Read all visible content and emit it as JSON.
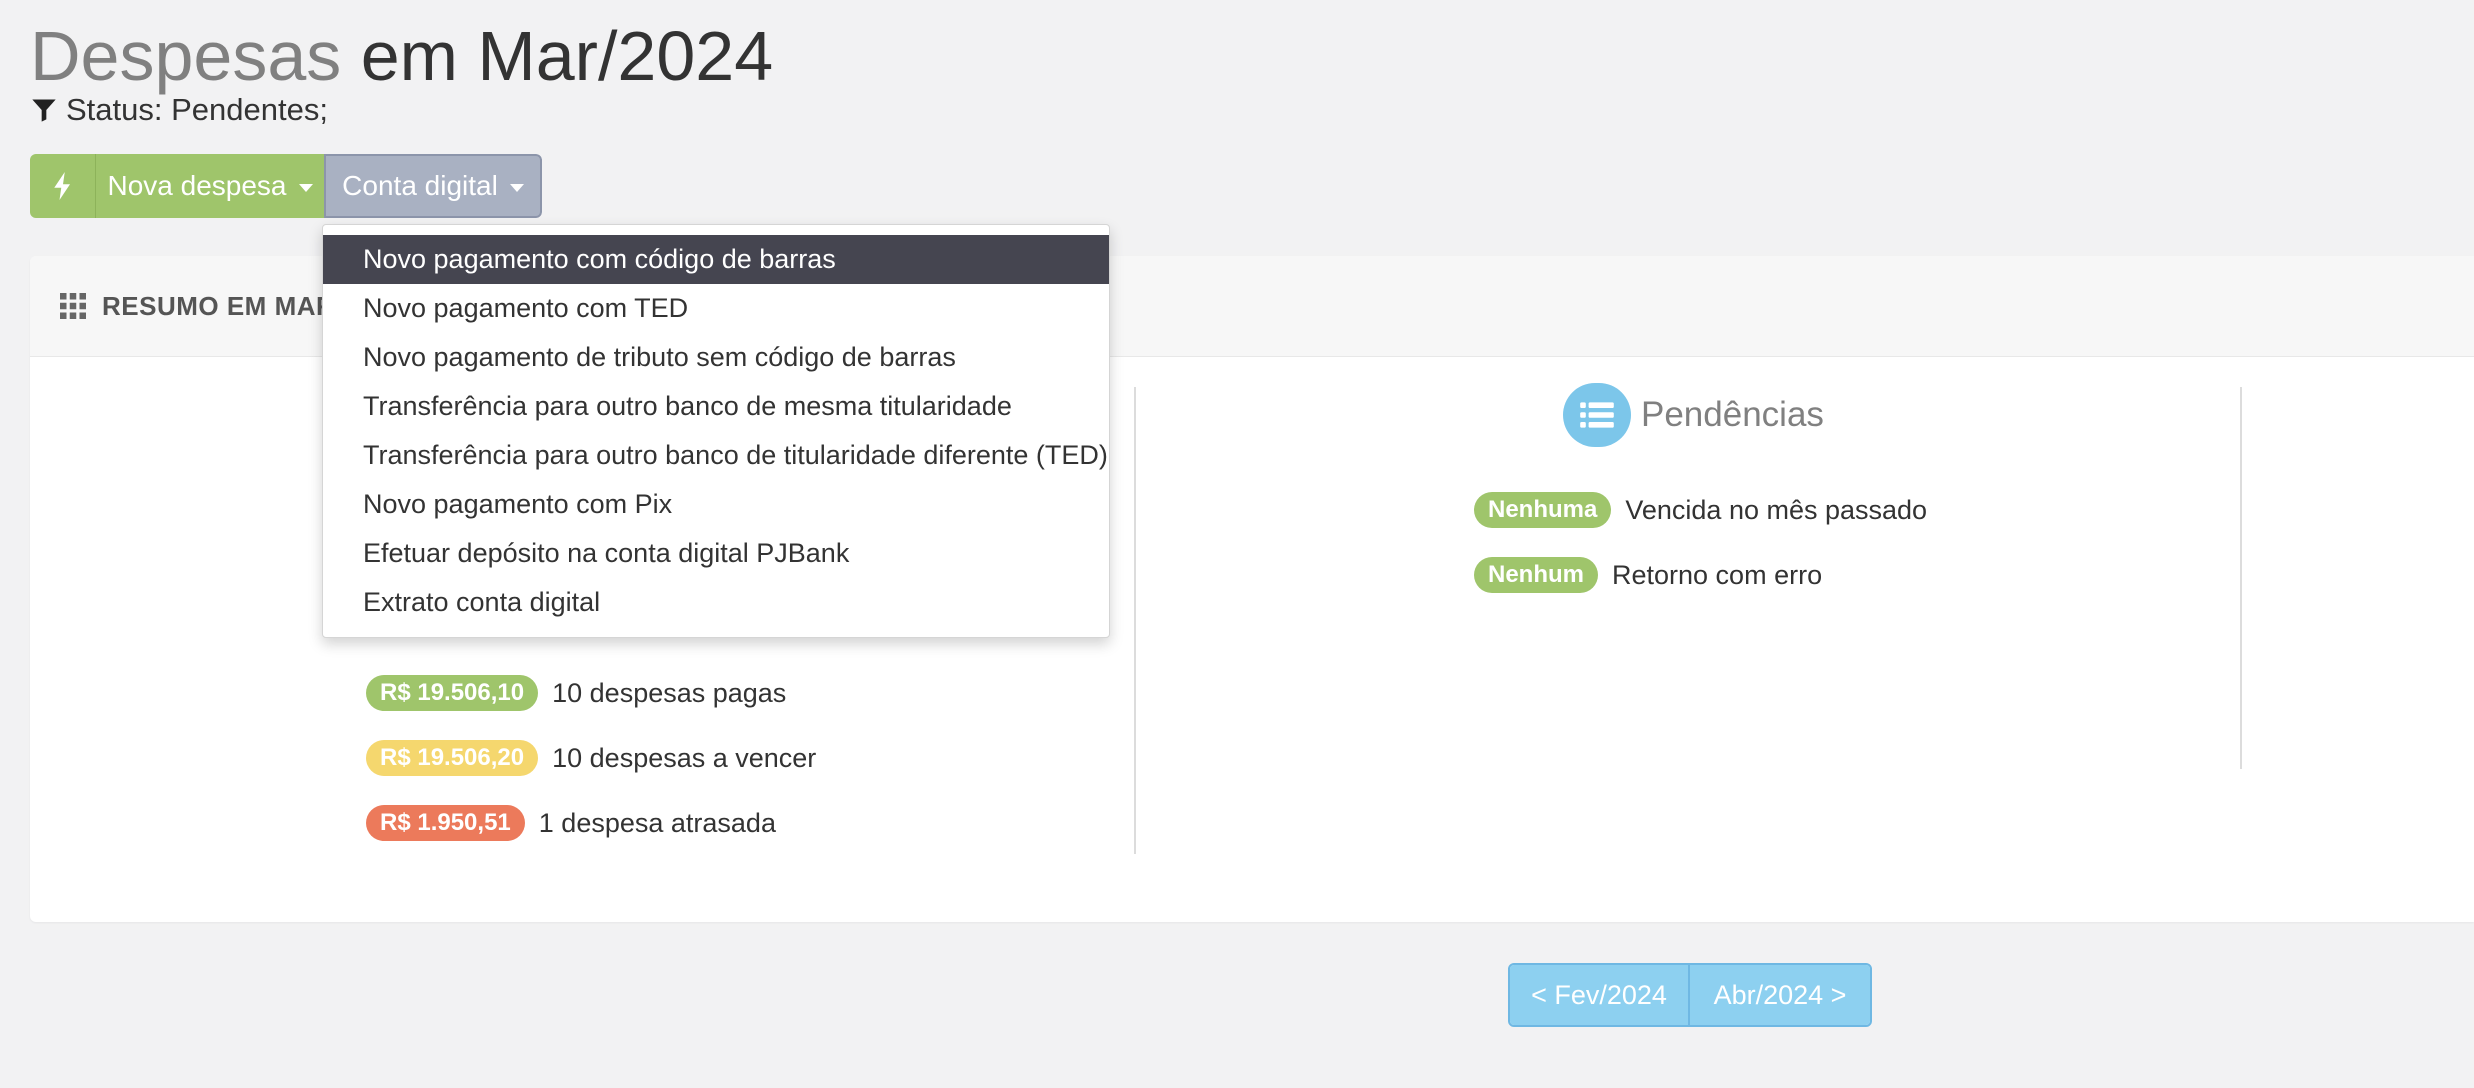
{
  "header": {
    "title_main": "Despesas",
    "title_sub": "em Mar/2024",
    "filter_status": "Status: Pendentes;"
  },
  "toolbar": {
    "nova_despesa_label": "Nova despesa",
    "conta_digital_label": "Conta digital"
  },
  "dropdown": {
    "items": [
      {
        "label": "Novo pagamento com código de barras"
      },
      {
        "label": "Novo pagamento com TED"
      },
      {
        "label": "Novo pagamento de tributo sem código de barras"
      },
      {
        "label": "Transferência para outro banco de mesma titularidade"
      },
      {
        "label": "Transferência para outro banco de titularidade diferente (TED)"
      },
      {
        "label": "Novo pagamento com Pix"
      },
      {
        "label": "Efetuar depósito na conta digital PJBank"
      },
      {
        "label": "Extrato conta digital"
      }
    ]
  },
  "panel": {
    "title": "RESUMO EM MAR",
    "summary": [
      {
        "amount": "R$ 19.506,10",
        "text": "10 despesas pagas",
        "color": "#9fc56b"
      },
      {
        "amount": "R$ 19.506,20",
        "text": "10 despesas a vencer",
        "color": "#f5d76e"
      },
      {
        "amount": "R$ 1.950,51",
        "text": "1 despesa atrasada",
        "color": "#ec7a5b"
      }
    ],
    "pendencias": {
      "title": "Pendências",
      "items": [
        {
          "badge": "Nenhuma",
          "text": "Vencida no mês passado"
        },
        {
          "badge": "Nenhum",
          "text": "Retorno com erro"
        }
      ]
    }
  },
  "pagination": {
    "prev_label": "< Fev/2024",
    "next_label": "Abr/2024 >"
  },
  "colors": {
    "accent_green": "#9fc56b",
    "accent_blue": "#8dd0f0",
    "dropdown_active": "#454550"
  }
}
